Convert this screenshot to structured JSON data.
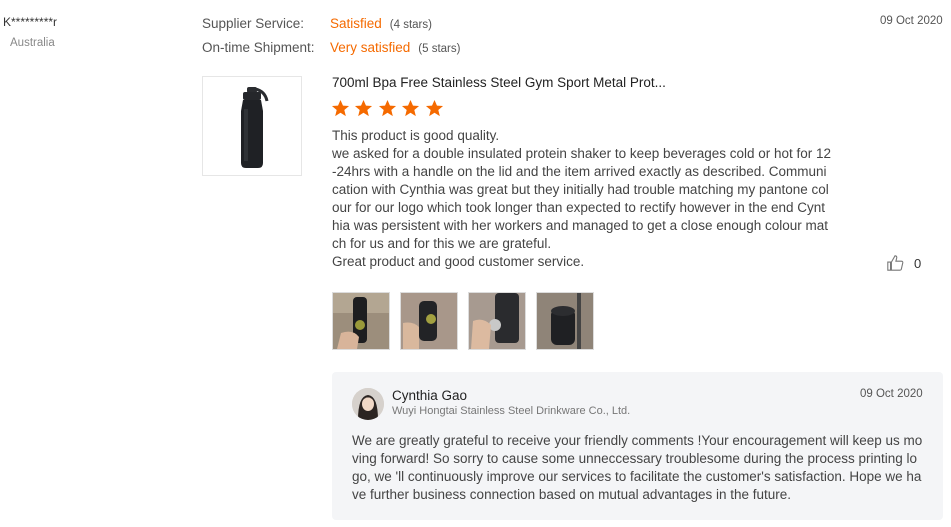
{
  "reviewer": {
    "name": "K*********r",
    "country": "Australia"
  },
  "ratings": [
    {
      "label": "Supplier Service:",
      "value": "Satisfied",
      "stars": "(4 stars)"
    },
    {
      "label": "On-time Shipment:",
      "value": "Very satisfied",
      "stars": "(5 stars)"
    }
  ],
  "review": {
    "date": "09 Oct 2020",
    "product_title": "700ml Bpa Free Stainless Steel Gym Sport Metal Prot...",
    "star_count": 5,
    "star_color": "#f56a00",
    "body": "This product is good quality.\nwe asked for a double insulated protein shaker to keep beverages cold or hot for 12-24hrs with a handle on the lid and the item arrived exactly as described. Communication with Cynthia was great but they initially had trouble matching my pantone colour for our logo which took longer than expected to rectify however in the end Cynthia was persistent with her workers and managed to get a close enough colour match for us and for this we are grateful.\nGreat product and good customer service.",
    "likes": "0",
    "photos": [
      "review-photo-1",
      "review-photo-2",
      "review-photo-3",
      "review-photo-4"
    ]
  },
  "reply": {
    "name": "Cynthia Gao",
    "company": "Wuyi Hongtai Stainless Steel Drinkware Co., Ltd.",
    "date": "09 Oct 2020",
    "body": "We are greatly grateful to receive your friendly comments !Your encouragement will keep us moving forward! So sorry to cause some unneccessary troublesome during the process printing logo, we 'll continuously improve our services to facilitate the customer's satisfaction. Hope we have further business connection based on mutual advantages in the future."
  },
  "icons": {
    "like": "thumbs-up-icon",
    "star": "star-icon"
  },
  "colors": {
    "accent": "#f56a00",
    "reply_bg": "#f4f5f7"
  }
}
